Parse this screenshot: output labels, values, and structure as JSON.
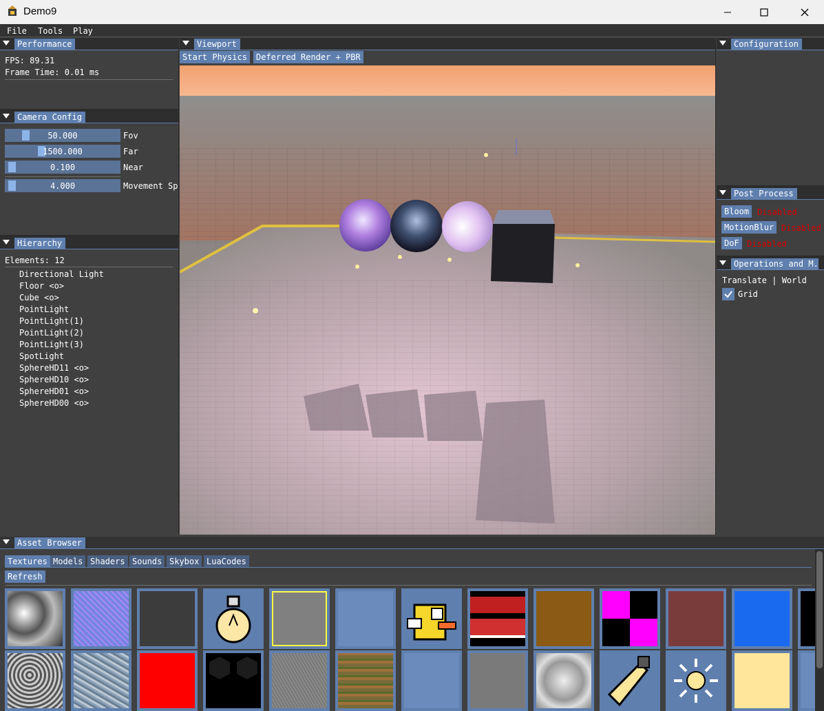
{
  "window": {
    "title": "Demo9"
  },
  "menu": {
    "items": [
      "File",
      "Tools",
      "Play"
    ]
  },
  "performance": {
    "tab": "Performance",
    "fps": "FPS: 89.31",
    "frame_time": "Frame Time: 0.01 ms"
  },
  "camera": {
    "tab": "Camera Config",
    "sliders": [
      {
        "value": "50.000",
        "label": "Fov",
        "fraction": 0.15
      },
      {
        "value": "1500.000",
        "label": "Far",
        "fraction": 0.3
      },
      {
        "value": "0.100",
        "label": "Near",
        "fraction": 0.02
      },
      {
        "value": "4.000",
        "label": "Movement Sp",
        "fraction": 0.02
      }
    ]
  },
  "hierarchy": {
    "tab": "Hierarchy",
    "count": "Elements: 12",
    "items": [
      "Directional Light",
      "Floor <o>",
      "Cube <o>",
      "PointLight",
      "PointLight(1)",
      "PointLight(2)",
      "PointLight(3)",
      "SpotLight",
      "SphereHD11 <o>",
      "SphereHD10 <o>",
      "SphereHD01 <o>",
      "SphereHD00 <o>"
    ]
  },
  "viewport": {
    "tab": "Viewport",
    "start_physics": "Start Physics",
    "render_mode": "Deferred Render + PBR"
  },
  "configuration": {
    "tab": "Configuration"
  },
  "postprocess": {
    "tab": "Post Process",
    "items": [
      {
        "name": "Bloom",
        "status": "Disabled"
      },
      {
        "name": "MotionBlur",
        "status": "Disabled"
      },
      {
        "name": "DoF",
        "status": "Disabled"
      }
    ]
  },
  "operations": {
    "tab": "Operations and M...",
    "mode": "Translate | World",
    "grid_label": "Grid",
    "grid_checked": true
  },
  "assets": {
    "tab": "Asset Browser",
    "tabs": [
      "Textures",
      "Models",
      "Shaders",
      "Sounds",
      "Skybox",
      "LuaCodes"
    ],
    "active_tab": "Textures",
    "refresh": "Refresh",
    "row1": [
      {
        "icon": "noise-grey-texture"
      },
      {
        "icon": "normal-map-texture"
      },
      {
        "icon": "dark-grey-texture"
      },
      {
        "icon": "lightbulb-icon"
      },
      {
        "icon": "grey-selected-texture"
      },
      {
        "icon": "blue-texture"
      },
      {
        "icon": "flappy-bird-sprite"
      },
      {
        "icon": "red-sprite-sheet"
      },
      {
        "icon": "brown-texture"
      },
      {
        "icon": "magenta-checker-texture"
      },
      {
        "icon": "maroon-texture"
      },
      {
        "icon": "bright-blue-texture"
      },
      {
        "icon": "black-texture"
      }
    ],
    "row2": [
      {
        "icon": "rock-texture"
      },
      {
        "icon": "stone-blue-texture"
      },
      {
        "icon": "red-texture"
      },
      {
        "icon": "hex-texture"
      },
      {
        "icon": "grey-stucco-texture"
      },
      {
        "icon": "bark-texture"
      },
      {
        "icon": "blue-texture-2"
      },
      {
        "icon": "grey-texture"
      },
      {
        "icon": "cloud-texture"
      },
      {
        "icon": "spotlight-icon"
      },
      {
        "icon": "sun-icon"
      },
      {
        "icon": "light-yellow-texture"
      },
      {
        "icon": "blue-texture-3"
      }
    ]
  },
  "colors": {
    "accent": "#5f7fae",
    "panel": "#404040",
    "status_disabled": "#e00000"
  }
}
